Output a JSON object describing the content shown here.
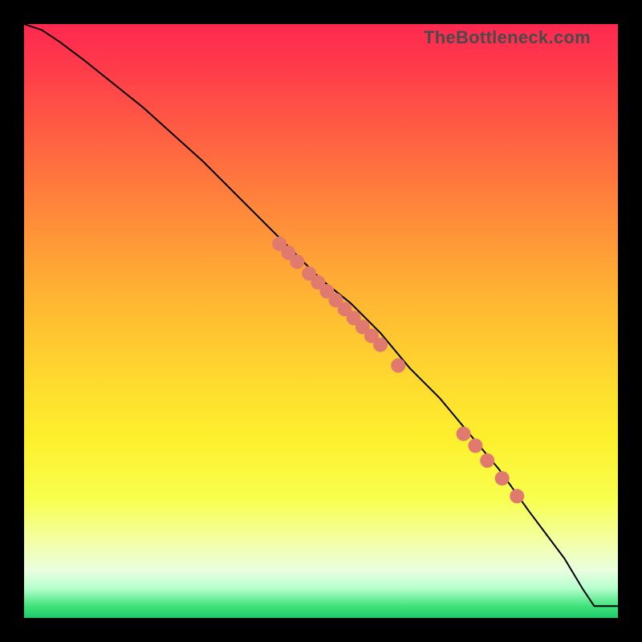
{
  "watermark_text": "TheBottleneck.com",
  "colors": {
    "marker": "#e07a6f",
    "curve": "#000000",
    "frame": "#000000"
  },
  "chart_data": {
    "type": "line",
    "title": "",
    "xlabel": "",
    "ylabel": "",
    "xlim": [
      0,
      100
    ],
    "ylim": [
      0,
      100
    ],
    "legend": false,
    "grid": false,
    "series": [
      {
        "name": "curve",
        "x": [
          0,
          3,
          6,
          10,
          15,
          20,
          30,
          40,
          50,
          55,
          60,
          65,
          70,
          75,
          80,
          85,
          88,
          91,
          94,
          96,
          100
        ],
        "y": [
          100,
          99,
          97,
          94,
          90,
          86,
          77,
          67,
          57,
          53,
          48,
          42,
          37,
          31,
          25,
          18,
          14,
          10,
          5,
          2,
          2
        ]
      }
    ],
    "markers": [
      {
        "x": 43,
        "y": 63
      },
      {
        "x": 44.5,
        "y": 61.5
      },
      {
        "x": 46,
        "y": 60
      },
      {
        "x": 48,
        "y": 58
      },
      {
        "x": 49.5,
        "y": 56.5
      },
      {
        "x": 51,
        "y": 55
      },
      {
        "x": 52.5,
        "y": 53.5
      },
      {
        "x": 54,
        "y": 52
      },
      {
        "x": 55.5,
        "y": 50.5
      },
      {
        "x": 57,
        "y": 49
      },
      {
        "x": 58.5,
        "y": 47.5
      },
      {
        "x": 60,
        "y": 46
      },
      {
        "x": 63,
        "y": 42.5
      },
      {
        "x": 74,
        "y": 31
      },
      {
        "x": 76,
        "y": 29
      },
      {
        "x": 78,
        "y": 26.5
      },
      {
        "x": 80.5,
        "y": 23.5
      },
      {
        "x": 83,
        "y": 20.5
      }
    ]
  }
}
